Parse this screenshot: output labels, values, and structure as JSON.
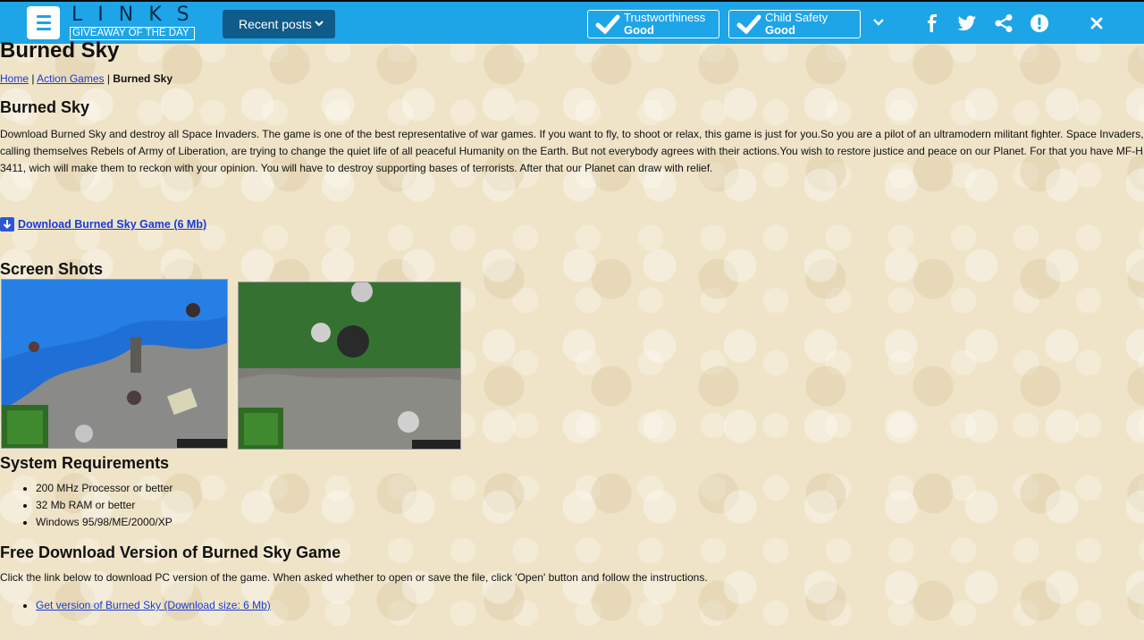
{
  "topbar": {
    "logo_word": "LINKS",
    "logo_sub": "GIVEAWAY OF THE DAY",
    "recent_posts": "Recent posts",
    "trust": {
      "title": "Trustworthiness",
      "value": "Good"
    },
    "child": {
      "title": "Child Safety",
      "value": "Good"
    },
    "icons": [
      "menu-icon",
      "chevron-down-icon",
      "facebook-icon",
      "twitter-icon",
      "share-icon",
      "alert-icon",
      "close-icon"
    ]
  },
  "page": {
    "title": "Burned Sky",
    "breadcrumb": {
      "home": "Home",
      "sep": "|",
      "category": "Action Games",
      "current": "Burned Sky"
    },
    "section_title": "Burned Sky",
    "description": "Download Burned Sky and destroy all Space Invaders. The game is one of the best representative of war games. If you want to fly, to shoot or relax, this game is just for you.So you are a pilot of an ultramodern militant fighter. Space Invaders, calling themselves Rebels of Army of Liberation, are trying to change the quiet life of all peaceful Humanity on the Earth. But not everybody agrees with their actions.You wish to restore justice and peace on our Planet. For that you have MF-H 3411, wich will make them to reckon with your opinion. You will have to destroy supporting bases of terrorists. After that our Planet can draw with relief.",
    "download_link": "Download Burned Sky Game (6 Mb)",
    "screens_title": "Screen Shots",
    "requirements_title": "System Requirements",
    "requirements": [
      "200 MHz Processor or better",
      "32 Mb RAM or better",
      "Windows 95/98/ME/2000/XP"
    ],
    "free_title": "Free Download Version of Burned Sky Game",
    "free_text": "Click the link below to download PC version of the game. When asked whether to open or save the file, click 'Open' button and follow the instructions.",
    "get_link": "Get version of Burned Sky (Download size: 6 Mb)"
  },
  "colors": {
    "topbar": "#1ea5e8",
    "dark_button": "#0f5b8a",
    "link": "#1a3ad8",
    "page_bg": "#efe4c8"
  }
}
